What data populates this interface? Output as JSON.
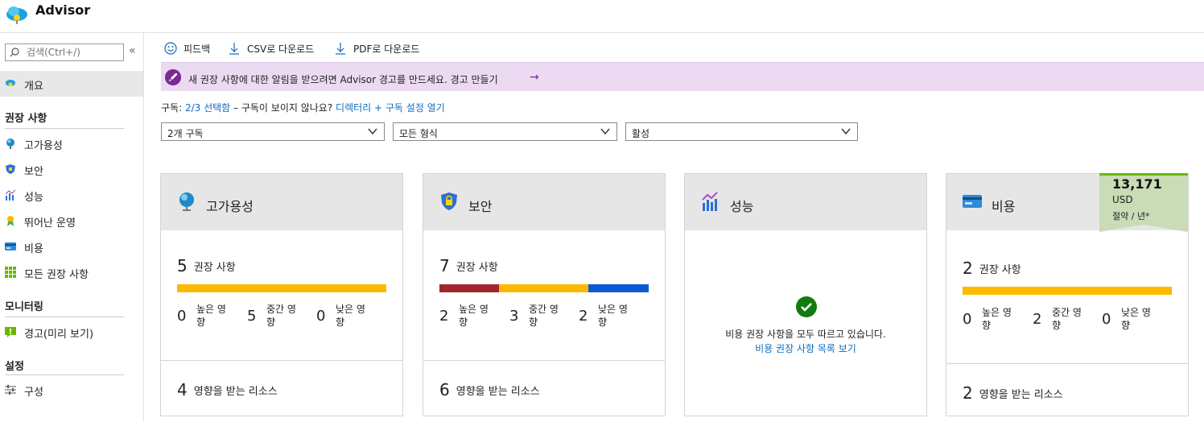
{
  "app": {
    "title": "Advisor"
  },
  "sidebar": {
    "search_placeholder": "검색(Ctrl+/)",
    "collapse": "«",
    "overview": "개요",
    "sections": [
      {
        "heading": "권장 사항",
        "items": [
          "고가용성",
          "보안",
          "성능",
          "뛰어난 운영",
          "비용",
          "모든 권장 사항"
        ]
      },
      {
        "heading": "모니터링",
        "items": [
          "경고(미리 보기)"
        ]
      },
      {
        "heading": "설정",
        "items": [
          "구성"
        ]
      }
    ]
  },
  "toolbar": {
    "feedback": "피드백",
    "csv": "CSV로 다운로드",
    "pdf": "PDF로 다운로드"
  },
  "banner": {
    "text": "새 권장 사항에 대한 알림을 받으려면 Advisor 경고를 만드세요. 경고 만들기",
    "arrow": "→"
  },
  "subscription": {
    "label": "구독:",
    "selected": "2/3 선택함",
    "question": "– 구독이 보이지 않나요?",
    "link": "디렉터리 + 구독 설정 열기"
  },
  "filters": {
    "subscriptions": "2개 구독",
    "types": "모든 형식",
    "status": "활성"
  },
  "labels": {
    "recommendations": "권장 사항",
    "high": "높은 영향",
    "medium": "중간 영향",
    "low": "낮은 영향",
    "affected": "영향을 받는 리소스"
  },
  "colors": {
    "high": "#a4262c",
    "medium": "#fcb900",
    "low": "#0a5bd3",
    "accent": "#0f6cbd",
    "success": "#107c10"
  },
  "cards": {
    "availability": {
      "title": "고가용성",
      "count": "5",
      "high": "0",
      "medium": "5",
      "low": "0",
      "resources": "4"
    },
    "security": {
      "title": "보안",
      "count": "7",
      "high": "2",
      "medium": "3",
      "low": "2",
      "resources": "6"
    },
    "performance": {
      "title": "성능",
      "message": "비용 권장 사항을 모두 따르고 있습니다.",
      "link": "비용 권장 사항 목록 보기"
    },
    "cost": {
      "title": "비용",
      "count": "2",
      "high": "0",
      "medium": "2",
      "low": "0",
      "resources": "2",
      "savings_amount": "13,171",
      "savings_currency": "USD",
      "savings_period": "절약 / 년*"
    }
  }
}
